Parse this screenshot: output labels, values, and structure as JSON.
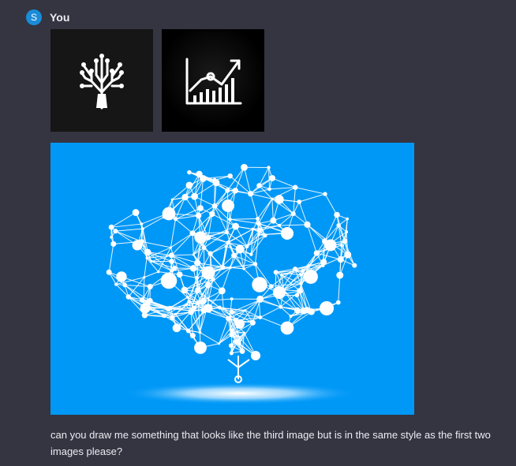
{
  "message": {
    "avatar_letter": "S",
    "author": "You",
    "text": "can you draw me something that looks like the third image but is in the same style as the first two images please?"
  },
  "attachments": [
    {
      "icon": "tree-circuit-icon"
    },
    {
      "icon": "growth-chart-icon"
    },
    {
      "icon": "brain-network-illustration"
    }
  ],
  "colors": {
    "background": "#343541",
    "avatar": "#1a8cd8",
    "brain_background": "#0098f7",
    "text": "#ececf1"
  }
}
